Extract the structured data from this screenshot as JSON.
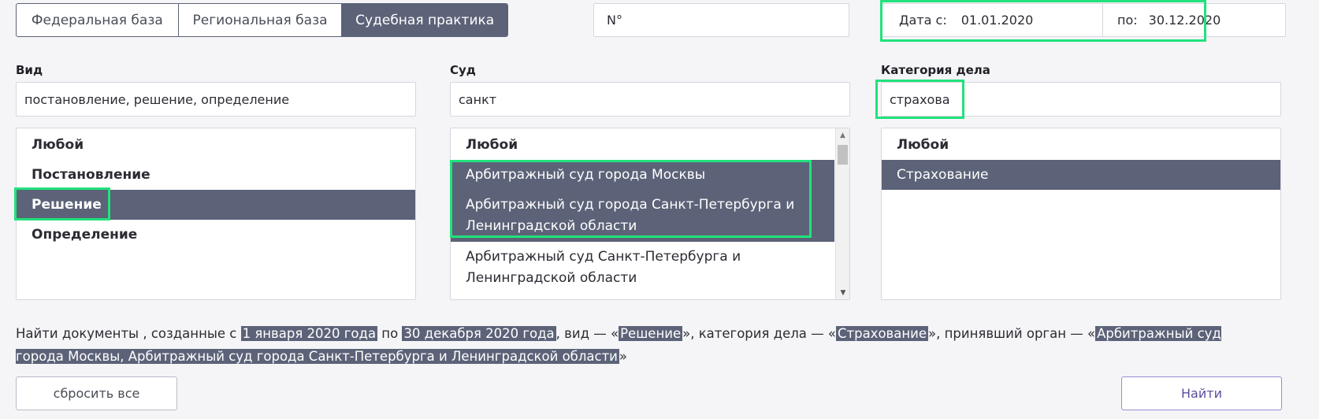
{
  "tabs": [
    "Федеральная база",
    "Региональная база",
    "Судебная практика"
  ],
  "active_tab": 2,
  "number_field": {
    "value": "N°"
  },
  "date_range": {
    "from_label": "Дата с:",
    "from_value": "01.01.2020",
    "to_label": "по:",
    "to_value": "30.12.2020"
  },
  "vid": {
    "label": "Вид",
    "input_value": "постановление, решение, определение",
    "options": [
      {
        "text": "Любой",
        "selected": false
      },
      {
        "text": "Постановление",
        "selected": false
      },
      {
        "text": "Решение",
        "selected": true
      },
      {
        "text": "Определение",
        "selected": false
      }
    ]
  },
  "sud": {
    "label": "Суд",
    "input_value": "санкт",
    "options": [
      {
        "text": "Любой",
        "selected": false
      },
      {
        "text": "Арбитражный суд города Москвы",
        "selected": true
      },
      {
        "text": "Арбитражный суд города Санкт-Петербурга и Ленинградской области",
        "selected": true
      },
      {
        "text": "Арбитражный суд Санкт-Петербурга и Ленинградской области",
        "selected": false
      }
    ]
  },
  "category": {
    "label": "Категория дела",
    "input_value": "страхова",
    "options": [
      {
        "text": "Любой",
        "selected": false
      },
      {
        "text": "Страхование",
        "selected": true
      }
    ]
  },
  "summary": {
    "prefix": "Найти документы , созданные с ",
    "date_from": "1 января 2020 года",
    "mid1": " по ",
    "date_to": "30 декабря 2020 года",
    "mid2": ", вид — «",
    "vid": "Решение",
    "mid3": "», категория дела — «",
    "category": "Страхование",
    "mid4": "», принявший орган — «",
    "organ": "Арбитражный суд города Москвы, Арбитражный суд города Санкт-Петербурга и Ленинградской области",
    "suffix": "»"
  },
  "buttons": {
    "reset": "сбросить все",
    "find": "Найти"
  },
  "colors": {
    "selected_bg": "#5c6378",
    "highlight": "#21e27c"
  }
}
